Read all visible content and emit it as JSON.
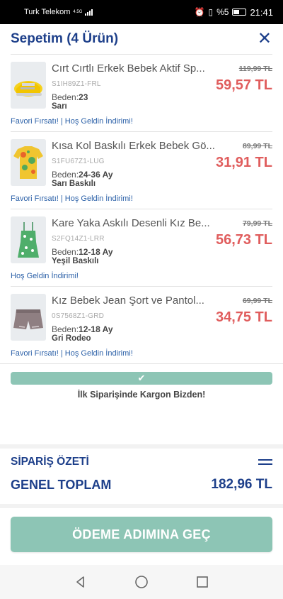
{
  "status_bar": {
    "carrier": "Turk Telekom",
    "network": "4.5G",
    "battery": "%5",
    "time": "21:41"
  },
  "header": {
    "title": "Sepetim (4 Ürün)",
    "close_icon": "close-icon"
  },
  "items": [
    {
      "name": "Cırt Cırtlı Erkek Bebek Aktif Sp...",
      "sku": "S1IH89Z1-FRL",
      "size_label": "Beden:",
      "size": "23",
      "color": "Sarı",
      "old_price": "119,99 TL",
      "price": "59,57 TL",
      "promo": "Favori Fırsatı! | Hoş Geldin İndirimi!"
    },
    {
      "name": "Kısa Kol Baskılı Erkek Bebek Gö...",
      "sku": "S1FU67Z1-LUG",
      "size_label": "Beden:",
      "size": "24-36 Ay",
      "color": "Sarı Baskılı",
      "old_price": "89,99 TL",
      "price": "31,91 TL",
      "promo": "Favori Fırsatı! | Hoş Geldin İndirimi!"
    },
    {
      "name": "Kare Yaka Askılı Desenli Kız Be...",
      "sku": "S2FQ14Z1-LRR",
      "size_label": "Beden:",
      "size": "12-18 Ay",
      "color": "Yeşil Baskılı",
      "old_price": "79,99 TL",
      "price": "56,73 TL",
      "promo": "Hoş Geldin İndirimi!"
    },
    {
      "name": "Kız Bebek Jean Şort ve Pantol...",
      "sku": "0S7568Z1-GRD",
      "size_label": "Beden:",
      "size": "12-18 Ay",
      "color": "Gri Rodeo",
      "old_price": "69,99 TL",
      "price": "34,75 TL",
      "promo": "Favori Fırsatı! | Hoş Geldin İndirimi!"
    }
  ],
  "shipping": {
    "check_icon": "check-icon",
    "message": "İlk Siparişinde Kargon Bizden!"
  },
  "summary": {
    "title": "SİPARİŞ ÖZETİ",
    "total_label": "GENEL TOPLAM",
    "total_value": "182,96 TL"
  },
  "cta": {
    "label": "ÖDEME ADIMINA GEÇ"
  },
  "colors": {
    "brand": "#1d3f8a",
    "price": "#e05d5d",
    "accent": "#8dc5b5",
    "link": "#2c61a8"
  }
}
